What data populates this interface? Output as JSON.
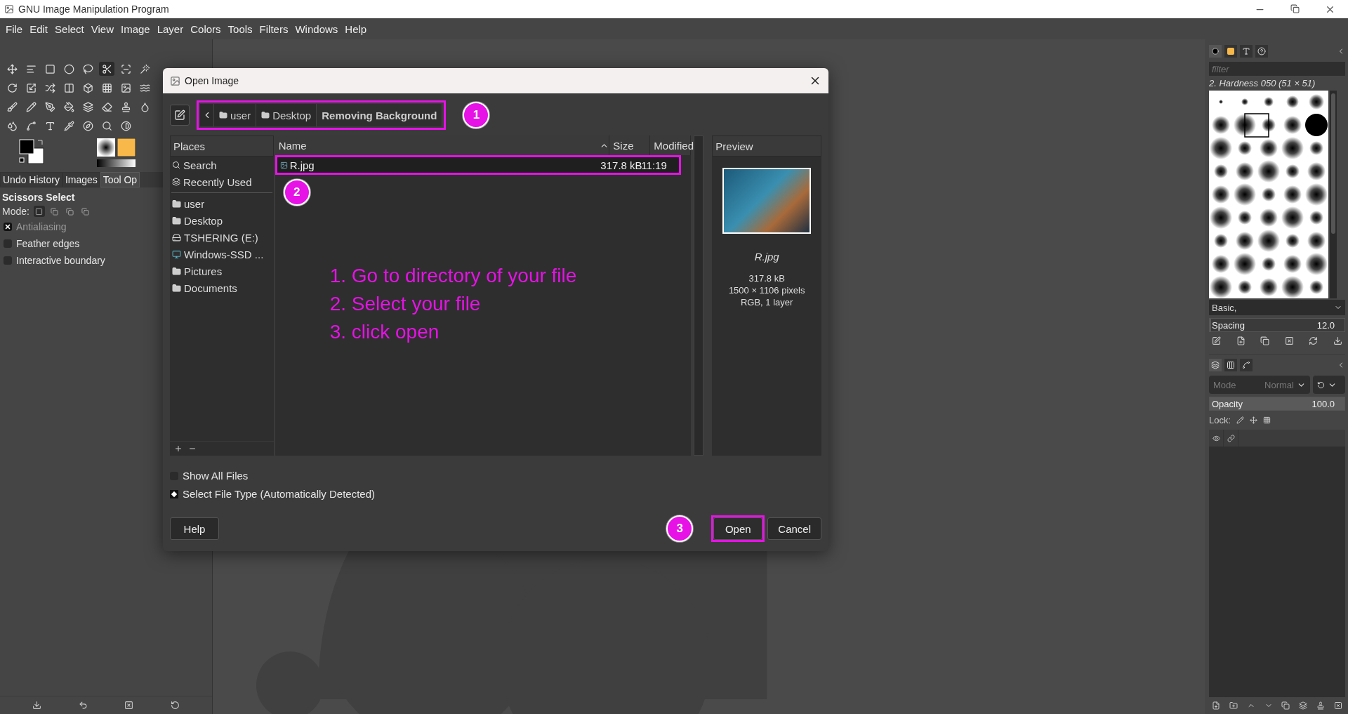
{
  "window": {
    "title": "GNU Image Manipulation Program"
  },
  "menu": [
    "File",
    "Edit",
    "Select",
    "View",
    "Image",
    "Layer",
    "Colors",
    "Tools",
    "Filters",
    "Windows",
    "Help"
  ],
  "dock_tabs": [
    {
      "label": "Undo History",
      "selected": false
    },
    {
      "label": "Images",
      "selected": false
    },
    {
      "label": "Tool Op",
      "selected": true
    }
  ],
  "tool_options": {
    "title": "Scissors Select",
    "mode_label": "Mode:",
    "options": [
      {
        "label": "Antialiasing",
        "checked": true,
        "disabled": true
      },
      {
        "label": "Feather edges",
        "checked": false,
        "disabled": false
      },
      {
        "label": "Interactive boundary",
        "checked": false,
        "disabled": false
      }
    ]
  },
  "dialog": {
    "title": "Open Image",
    "path": [
      {
        "label": "user",
        "selected": false
      },
      {
        "label": "Desktop",
        "selected": false
      },
      {
        "label": "Removing Background",
        "selected": true
      }
    ],
    "places": {
      "header": "Places",
      "items": [
        {
          "label": "Search",
          "kind": "search"
        },
        {
          "label": "Recently Used",
          "kind": "recent"
        },
        {
          "label": "user",
          "kind": "folder"
        },
        {
          "label": "Desktop",
          "kind": "folder"
        },
        {
          "label": "TSHERING (E:)",
          "kind": "drive"
        },
        {
          "label": "Windows-SSD ...",
          "kind": "system"
        },
        {
          "label": "Pictures",
          "kind": "folder"
        },
        {
          "label": "Documents",
          "kind": "folder"
        }
      ]
    },
    "files": {
      "columns": [
        "Name",
        "Size",
        "Modified"
      ],
      "rows": [
        {
          "name": "R.jpg",
          "size": "317.8 kB",
          "modified": "11:19",
          "selected": true
        }
      ]
    },
    "preview": {
      "header": "Preview",
      "file_name": "R.jpg",
      "lines": [
        "317.8 kB",
        "1500 × 1106 pixels",
        "RGB, 1 layer"
      ]
    },
    "options": [
      {
        "label": "Show All Files",
        "kind": "checkbox",
        "checked": false
      },
      {
        "label": "Select File Type (Automatically Detected)",
        "kind": "expander"
      }
    ],
    "buttons": [
      {
        "label": "Help",
        "kind": "help"
      },
      {
        "label": "Open",
        "kind": "primary"
      },
      {
        "label": "Cancel",
        "kind": "secondary"
      }
    ]
  },
  "annotations": {
    "markers": [
      "1",
      "2",
      "3"
    ],
    "instructions": [
      "1. Go to directory of your file",
      "2. Select your file",
      "3. click open"
    ]
  },
  "brushes": {
    "filter_placeholder": "filter",
    "selected_brush": "2. Hardness 050 (51 × 51)",
    "tag": "Basic,",
    "spacing": {
      "label": "Spacing",
      "reading": "12.0",
      "level": 0.01
    }
  },
  "layers": {
    "mode_label": "Mode",
    "mode_value": "Normal",
    "opacity": {
      "label": "Opacity",
      "reading": "100.0",
      "level": 1
    },
    "lock_label": "Lock:"
  }
}
